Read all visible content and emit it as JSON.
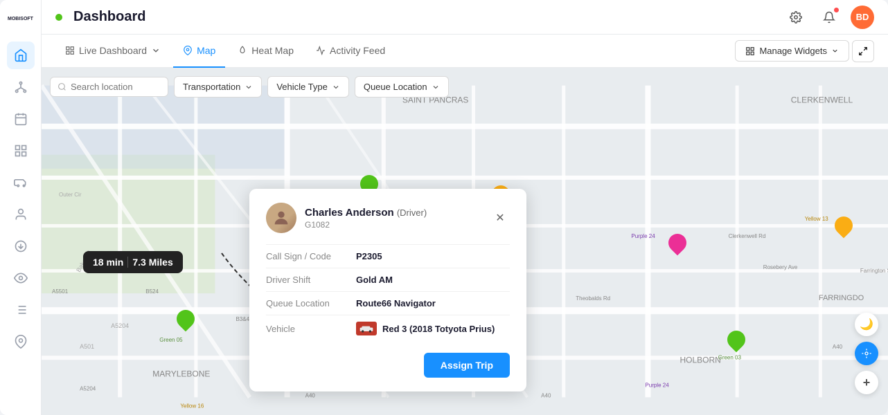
{
  "app": {
    "logo": "MOBISOFT",
    "title": "Dashboard",
    "status": "online"
  },
  "header": {
    "title": "Dashboard",
    "settings_label": "settings",
    "notifications_label": "notifications",
    "user_initials": "BD"
  },
  "nav": {
    "tabs": [
      {
        "id": "live-dashboard",
        "label": "Live Dashboard",
        "icon": "grid-icon",
        "has_dropdown": true,
        "active": false
      },
      {
        "id": "map",
        "label": "Map",
        "icon": "map-icon",
        "has_dropdown": false,
        "active": true
      },
      {
        "id": "heat-map",
        "label": "Heat Map",
        "icon": "flame-icon",
        "has_dropdown": false,
        "active": false
      },
      {
        "id": "activity-feed",
        "label": "Activity Feed",
        "icon": "list-icon",
        "has_dropdown": false,
        "active": false
      }
    ],
    "manage_widgets_label": "Manage Widgets",
    "fullscreen_label": "fullscreen"
  },
  "filters": {
    "search_placeholder": "Search location",
    "dropdowns": [
      {
        "id": "transportation",
        "label": "Transportation"
      },
      {
        "id": "vehicle-type",
        "label": "Vehicle Type"
      },
      {
        "id": "queue-location",
        "label": "Queue Location"
      }
    ]
  },
  "distance_badge": {
    "time": "18 min",
    "distance": "7.3 Miles"
  },
  "driver_popup": {
    "name": "Charles Anderson",
    "role": "(Driver)",
    "id": "G1082",
    "fields": [
      {
        "label": "Call Sign / Code",
        "value": "P2305"
      },
      {
        "label": "Driver Shift",
        "value": "Gold AM"
      },
      {
        "label": "Queue Location",
        "value": "Route66 Navigator"
      },
      {
        "label": "Vehicle",
        "value": "Red 3 (2018 Totyota Prius)",
        "has_icon": true
      }
    ],
    "assign_btn_label": "Assign Trip"
  },
  "sidebar": {
    "items": [
      {
        "id": "home",
        "icon": "home-icon",
        "active": true
      },
      {
        "id": "org",
        "icon": "org-icon",
        "active": false
      },
      {
        "id": "calendar",
        "icon": "calendar-icon",
        "active": false
      },
      {
        "id": "analytics",
        "icon": "analytics-icon",
        "active": false
      },
      {
        "id": "car",
        "icon": "car-icon",
        "active": false
      },
      {
        "id": "user",
        "icon": "user-icon",
        "active": false
      },
      {
        "id": "vehicle2",
        "icon": "vehicle2-icon",
        "active": false
      },
      {
        "id": "eye",
        "icon": "eye-icon",
        "active": false
      },
      {
        "id": "list",
        "icon": "list-icon2",
        "active": false
      },
      {
        "id": "pin",
        "icon": "pin-icon",
        "active": false
      }
    ]
  },
  "map_controls": [
    {
      "id": "dark-mode",
      "icon": "moon-icon",
      "active": false
    },
    {
      "id": "location",
      "icon": "location-icon",
      "active": true
    },
    {
      "id": "zoom-in",
      "icon": "plus-icon",
      "active": false
    }
  ]
}
